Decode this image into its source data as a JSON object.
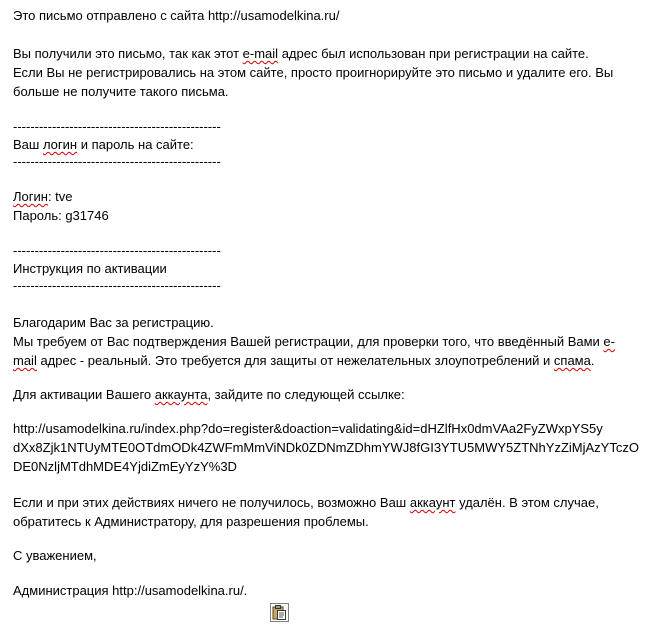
{
  "email": {
    "intro": "Это письмо отправлено с сайта http://usamodelkina.ru/",
    "notice": {
      "l1a": "Вы получили это письмо, так как этот ",
      "l1_email": "e-mail",
      "l1b": " адрес был использован при регистрации на сайте.",
      "l2": "Если Вы не регистрировались на этом сайте, просто проигнорируйте это письмо и удалите его. Вы",
      "l3": "больше не получите такого письма."
    },
    "divider": "------------------------------------------------",
    "login_section": {
      "a": "Ваш ",
      "login_word": "логин",
      "b": " и пароль на сайте:"
    },
    "credentials": {
      "login_label": "Логин",
      "login_value": ": tve",
      "password_line": "Пароль: g31746"
    },
    "activation_heading": "Инструкция по активации",
    "thanks": "Благодарим Вас за регистрацию.",
    "confirm": {
      "l1a": "Мы требуем от Вас подтверждения Вашей регистрации, для проверки того, что введённый Вами ",
      "l1_e": "e-",
      "l2_mail": "mail",
      "l2a": " адрес - реальный. Это требуется для защиты от нежелательных злоупотреблений и ",
      "l2_spam": "спама",
      "l2b": "."
    },
    "activate": {
      "a": "Для активации Вашего ",
      "account": "аккаунта",
      "b": ", зайдите по следующей ссылке:"
    },
    "link": {
      "l1": "http://usamodelkina.ru/index.php?do=register&doaction=validating&id=dHZlfHx0dmVAa2FyZWxpYS5y",
      "l2": "dXx8Zjk1NTUyMTE0OTdmODk4ZWFmMmViNDk0ZDNmZDhmYWJ8fGI3YTU5MWY5ZTNhYzZiMjAzYTczO",
      "l3": "DE0NzljMTdhMDE4YjdiZmEyYzY%3D"
    },
    "problem": {
      "l1a": "Если и при этих действиях ничего не получилось, возможно Ваш ",
      "account": "аккаунт",
      "l1b": " удалён. В этом случае,",
      "l2": "обратитесь к Администратору, для разрешения проблемы."
    },
    "regards": "С уважением,",
    "signature": "Администрация http://usamodelkina.ru/."
  },
  "icons": {
    "paste_options": "paste-options-icon"
  },
  "colors": {
    "text": "#000000",
    "spell_underline": "#d00000",
    "background": "#ffffff"
  }
}
